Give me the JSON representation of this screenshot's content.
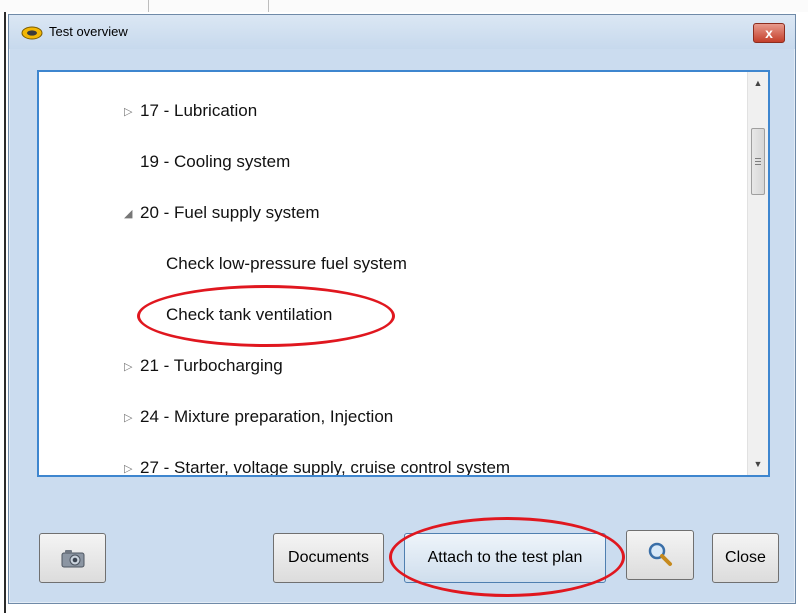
{
  "window": {
    "title": "Test overview",
    "close_glyph": "x",
    "icon": "app-logo-icon"
  },
  "tree": {
    "items": [
      {
        "label": "17 - Lubrication",
        "toggle": "collapsed"
      },
      {
        "label": "19 - Cooling system",
        "toggle": "none"
      },
      {
        "label": "20 - Fuel supply system",
        "toggle": "expanded"
      },
      {
        "label": "Check low-pressure fuel system",
        "toggle": "none"
      },
      {
        "label": "Check tank ventilation",
        "toggle": "none",
        "annotated": true
      },
      {
        "label": "21 - Turbocharging",
        "toggle": "collapsed"
      },
      {
        "label": "24 - Mixture preparation, Injection",
        "toggle": "collapsed"
      },
      {
        "label": "27 - Starter, voltage supply, cruise control system",
        "toggle": "collapsed"
      }
    ],
    "glyphs": {
      "collapsed": "▷",
      "expanded": "◢"
    }
  },
  "scrollbar": {
    "up_glyph": "▲",
    "down_glyph": "▼"
  },
  "buttons": {
    "camera": {
      "icon": "camera-icon"
    },
    "documents": "Documents",
    "attach": "Attach to the test plan",
    "search": {
      "icon": "magnifier-icon"
    },
    "close": "Close"
  },
  "colors": {
    "window_bg": "#cbdcef",
    "list_border": "#3e86cf",
    "annotation": "#e0171f"
  }
}
